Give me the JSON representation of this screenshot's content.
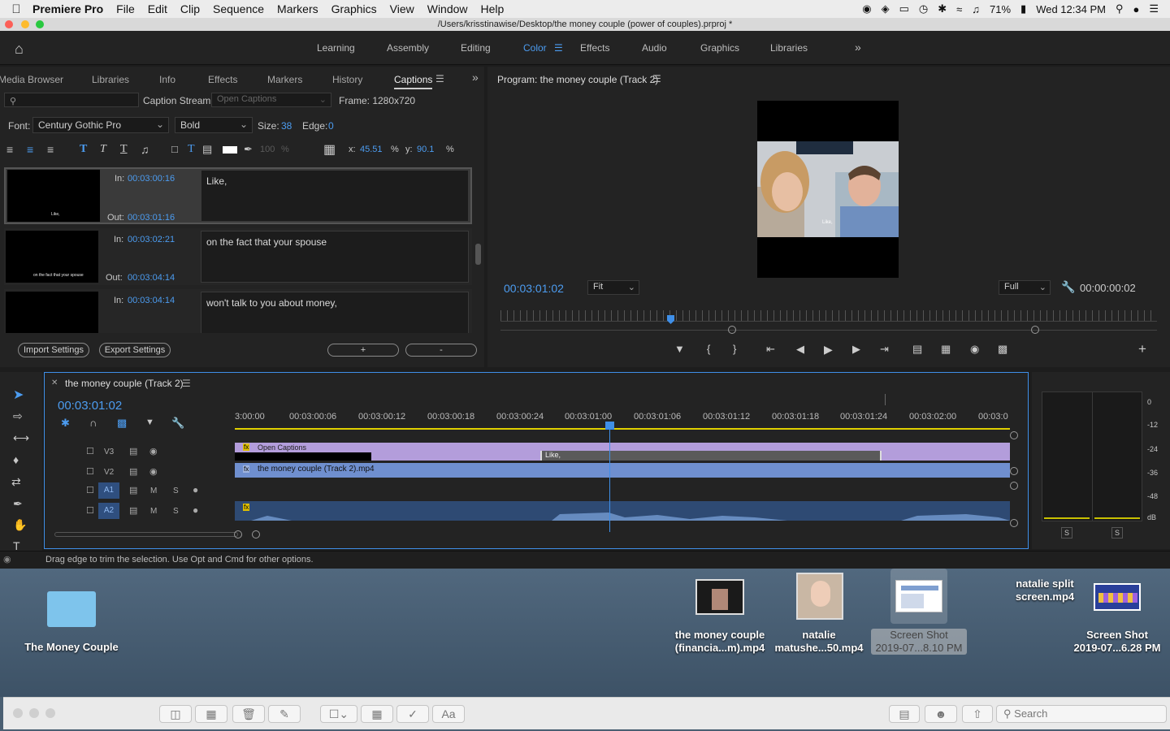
{
  "menubar": {
    "app_name": "Premiere Pro",
    "items": [
      "File",
      "Edit",
      "Clip",
      "Sequence",
      "Markers",
      "Graphics",
      "View",
      "Window",
      "Help"
    ],
    "battery": "71%",
    "clock": "Wed 12:34 PM"
  },
  "window": {
    "title": "/Users/krisstinawise/Desktop/the money couple (power of couples).prproj *"
  },
  "workspaces": [
    "Learning",
    "Assembly",
    "Editing",
    "Color",
    "Effects",
    "Audio",
    "Graphics",
    "Libraries"
  ],
  "workspaces_active": "Color",
  "left_panel": {
    "tabs": [
      "Media Browser",
      "Libraries",
      "Info",
      "Effects",
      "Markers",
      "History",
      "Captions"
    ],
    "active_tab": "Captions",
    "caption_stream_label": "Caption Stream:",
    "caption_stream_value": "Open Captions",
    "frame_label": "Frame: 1280x720",
    "font_label": "Font:",
    "font_value": "Century Gothic Pro",
    "weight_value": "Bold",
    "size_label": "Size:",
    "size_value": "38",
    "edge_label": "Edge:",
    "edge_value": "0",
    "opacity_value": "100",
    "opacity_unit": "%",
    "x_label": "x:",
    "x_value": "45.51",
    "y_label": "y:",
    "y_value": "90.1",
    "pct": "%",
    "captions": [
      {
        "in_label": "In:",
        "in": "00:03:00:16",
        "out_label": "Out:",
        "out": "00:03:01:16",
        "text": "Like,",
        "thumb": "Like,"
      },
      {
        "in_label": "In:",
        "in": "00:03:02:21",
        "out_label": "Out:",
        "out": "00:03:04:14",
        "text": "on the fact that your spouse",
        "thumb": "on the fact that your spouse"
      },
      {
        "in_label": "In:",
        "in": "00:03:04:14",
        "text": "won't talk to you about money,"
      }
    ],
    "import_btn": "Import Settings",
    "export_btn": "Export Settings",
    "add_btn": "+",
    "remove_btn": "-"
  },
  "program": {
    "title": "Program: the money couple (Track 2)",
    "timecode": "00:03:01:02",
    "zoom": "Fit",
    "resolution": "Full",
    "duration": "00:00:00:02"
  },
  "timeline": {
    "tab_title": "the money couple (Track 2)",
    "timecode": "00:03:01:02",
    "ruler": [
      "3:00:00",
      "00:03:00:06",
      "00:03:00:12",
      "00:03:00:18",
      "00:03:00:24",
      "00:03:01:00",
      "00:03:01:06",
      "00:03:01:12",
      "00:03:01:18",
      "00:03:01:24",
      "00:03:02:00",
      "00:03:0"
    ],
    "tracks": [
      {
        "name": "V3",
        "type": "video"
      },
      {
        "name": "V2",
        "type": "video"
      },
      {
        "name": "A1",
        "type": "audio",
        "m": "M",
        "s": "S"
      },
      {
        "name": "A2",
        "type": "audio",
        "m": "M",
        "s": "S"
      }
    ],
    "clip_captions": "Open Captions",
    "clip_caption_like": "Like,",
    "clip_video": "the money couple (Track 2).mp4",
    "fx": "fx"
  },
  "meter": {
    "scale": [
      "0",
      "-12",
      "-24",
      "-36",
      "-48",
      "dB"
    ],
    "solo": [
      "S",
      "S"
    ]
  },
  "status": {
    "text": "Drag edge to trim the selection. Use Opt and Cmd for other options."
  },
  "desktop": {
    "icons": [
      {
        "label": "The Money Couple"
      },
      {
        "label_1": "the money couple",
        "label_2": "(financia...m).mp4"
      },
      {
        "label_1": "natalie",
        "label_2": "matushe...50.mp4"
      },
      {
        "label_1": "Screen Shot",
        "label_2": "2019-07...8.10 PM"
      },
      {
        "label_1": "natalie split",
        "label_2": "screen.mp4"
      },
      {
        "label_1": "Screen Shot",
        "label_2": "2019-07...6.28 PM"
      }
    ]
  },
  "finder": {
    "search_placeholder": "Search",
    "font_btn": "Aa"
  },
  "colors": {
    "accent": "#4c9cf0",
    "caption_clip": "#b39ddb",
    "video_clip": "#6f8fcf",
    "audio_clip": "#3a5f8f",
    "playhead": "#3f8fe8"
  }
}
